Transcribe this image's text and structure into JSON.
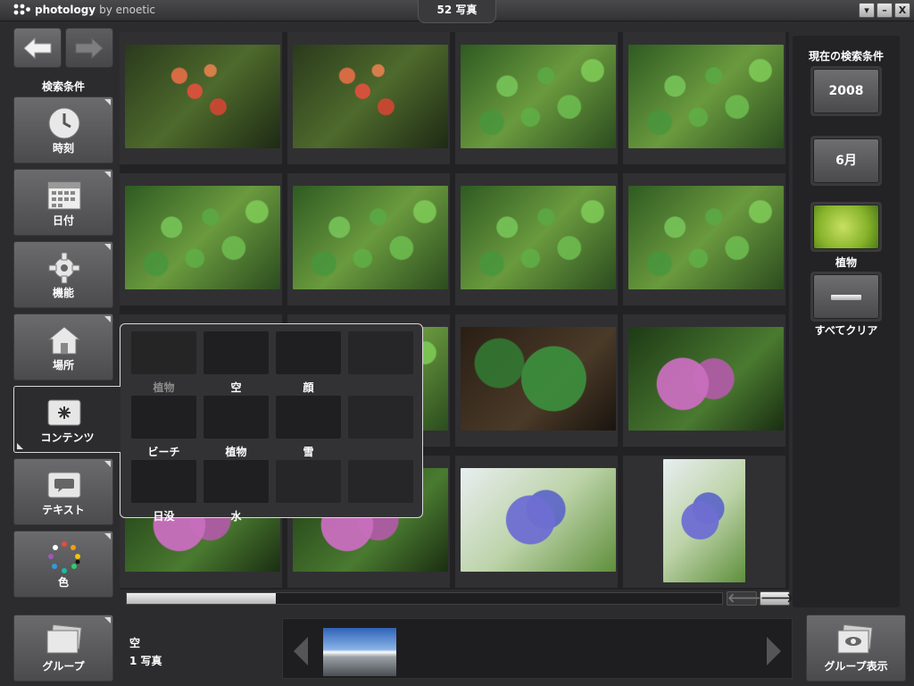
{
  "titlebar": {
    "brand_name": "photology",
    "brand_by": "by enoetic",
    "center_title": "52 写真",
    "buttons": {
      "menu": "▾",
      "minimize": "–",
      "close": "X"
    }
  },
  "nav": {
    "back_icon": "left-arrow-icon",
    "forward_icon": "right-arrow-icon"
  },
  "sidebar": {
    "search_conditions_label": "検索条件",
    "items": [
      {
        "label": "時刻",
        "icon": "clock-icon"
      },
      {
        "label": "日付",
        "icon": "calendar-icon"
      },
      {
        "label": "機能",
        "icon": "gear-icon"
      },
      {
        "label": "場所",
        "icon": "house-icon"
      },
      {
        "label": "コンテンツ",
        "icon": "asterisk-icon",
        "active": true
      },
      {
        "label": "テキスト",
        "icon": "speech-bubble-icon"
      },
      {
        "label": "色",
        "icon": "color-wheel-icon"
      }
    ]
  },
  "grid": {
    "rows": [
      [
        "redleaf",
        "redleaf",
        "leafy",
        "leafy"
      ],
      [
        "leafy",
        "leafy",
        "leafy",
        "leafy"
      ],
      [
        "leafy",
        "leafy",
        "bigleaf",
        "hydra-pink"
      ],
      [
        "hydra-pink",
        "hydra-pink",
        "hydra-blue",
        "hydra-blue"
      ]
    ]
  },
  "content_popup": {
    "categories": [
      {
        "label": "植物",
        "img": "img-plants",
        "disabled": true
      },
      {
        "label": "空",
        "img": "img-sky"
      },
      {
        "label": "顔",
        "img": "img-face"
      },
      {
        "label": "",
        "img": "empty"
      },
      {
        "label": "ビーチ",
        "img": "img-beach"
      },
      {
        "label": "植物",
        "img": "img-sunflower"
      },
      {
        "label": "雪",
        "img": "img-snow"
      },
      {
        "label": "",
        "img": "empty"
      },
      {
        "label": "日没",
        "img": "img-sunset"
      },
      {
        "label": "水",
        "img": "img-water"
      },
      {
        "label": "",
        "img": "empty"
      },
      {
        "label": "",
        "img": "empty"
      }
    ]
  },
  "right_panel": {
    "title": "現在の検索条件",
    "year": "2008",
    "month": "6月",
    "plant_label": "植物",
    "clear_all_label": "すべてクリア"
  },
  "scroll": {
    "left_arrow": "🡐",
    "right_arrow": "🡒",
    "position_fraction": 0.25
  },
  "bottom": {
    "group_label": "グループ",
    "group_name": "空",
    "group_count": "1 写真",
    "group_view_label": "グループ表示"
  }
}
